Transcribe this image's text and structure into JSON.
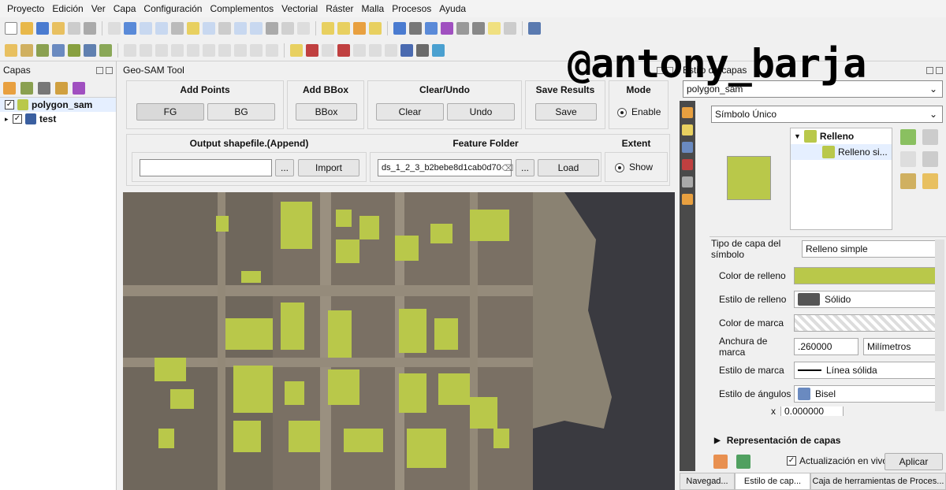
{
  "menu": [
    "Proyecto",
    "Edición",
    "Ver",
    "Capa",
    "Configuración",
    "Complementos",
    "Vectorial",
    "Ráster",
    "Malla",
    "Procesos",
    "Ayuda"
  ],
  "layers_panel": {
    "title": "Capas",
    "layers": [
      {
        "name": "polygon_sam",
        "checked": true,
        "swatch": "#b9c84a"
      },
      {
        "name": "test",
        "checked": true,
        "swatch": "#3a5fa0"
      }
    ]
  },
  "geosam": {
    "title": "Geo-SAM Tool",
    "add_points": {
      "title": "Add Points",
      "fg": "FG",
      "bg": "BG"
    },
    "add_bbox": {
      "title": "Add BBox",
      "bbox": "BBox"
    },
    "clear_undo": {
      "title": "Clear/Undo",
      "clear": "Clear",
      "undo": "Undo"
    },
    "save_results": {
      "title": "Save Results",
      "save": "Save"
    },
    "mode": {
      "title": "Mode",
      "option": "Enable"
    },
    "output": {
      "title": "Output shapefile.(Append)",
      "value": "",
      "browse": "...",
      "import": "Import"
    },
    "feature_folder": {
      "title": "Feature Folder",
      "value": "ds_1_2_3_b2bebe8d1cab0d70",
      "browse": "...",
      "load": "Load"
    },
    "extent": {
      "title": "Extent",
      "option": "Show"
    }
  },
  "styling": {
    "title": "Estilo de capas",
    "layer": "polygon_sam",
    "renderer": "Símbolo Único",
    "tree": {
      "root": "Relleno",
      "child": "Relleno si..."
    },
    "fill_color": "#b9c84a",
    "props": [
      {
        "label": "Tipo de capa del símbolo",
        "value": "Relleno simple"
      },
      {
        "label": "Color de relleno",
        "value": ""
      },
      {
        "label": "Estilo de relleno",
        "value": "Sólido"
      },
      {
        "label": "Color de marca",
        "value": ""
      },
      {
        "label": "Anchura de marca",
        "value": ".260000",
        "unit": "Milímetros"
      },
      {
        "label": "Estilo de marca",
        "value": "Línea sólida"
      },
      {
        "label": "Estilo de ángulos",
        "value": "Bisel"
      },
      {
        "label": "x",
        "value": "0.000000"
      }
    ],
    "layer_rendering": "Representación de capas",
    "live_update": "Actualización en vivo",
    "apply": "Aplicar"
  },
  "bottom_tabs": [
    "Navegad...",
    "Estilo de cap...",
    "Caja de herramientas de Proces..."
  ],
  "watermark": "@antony_barja"
}
